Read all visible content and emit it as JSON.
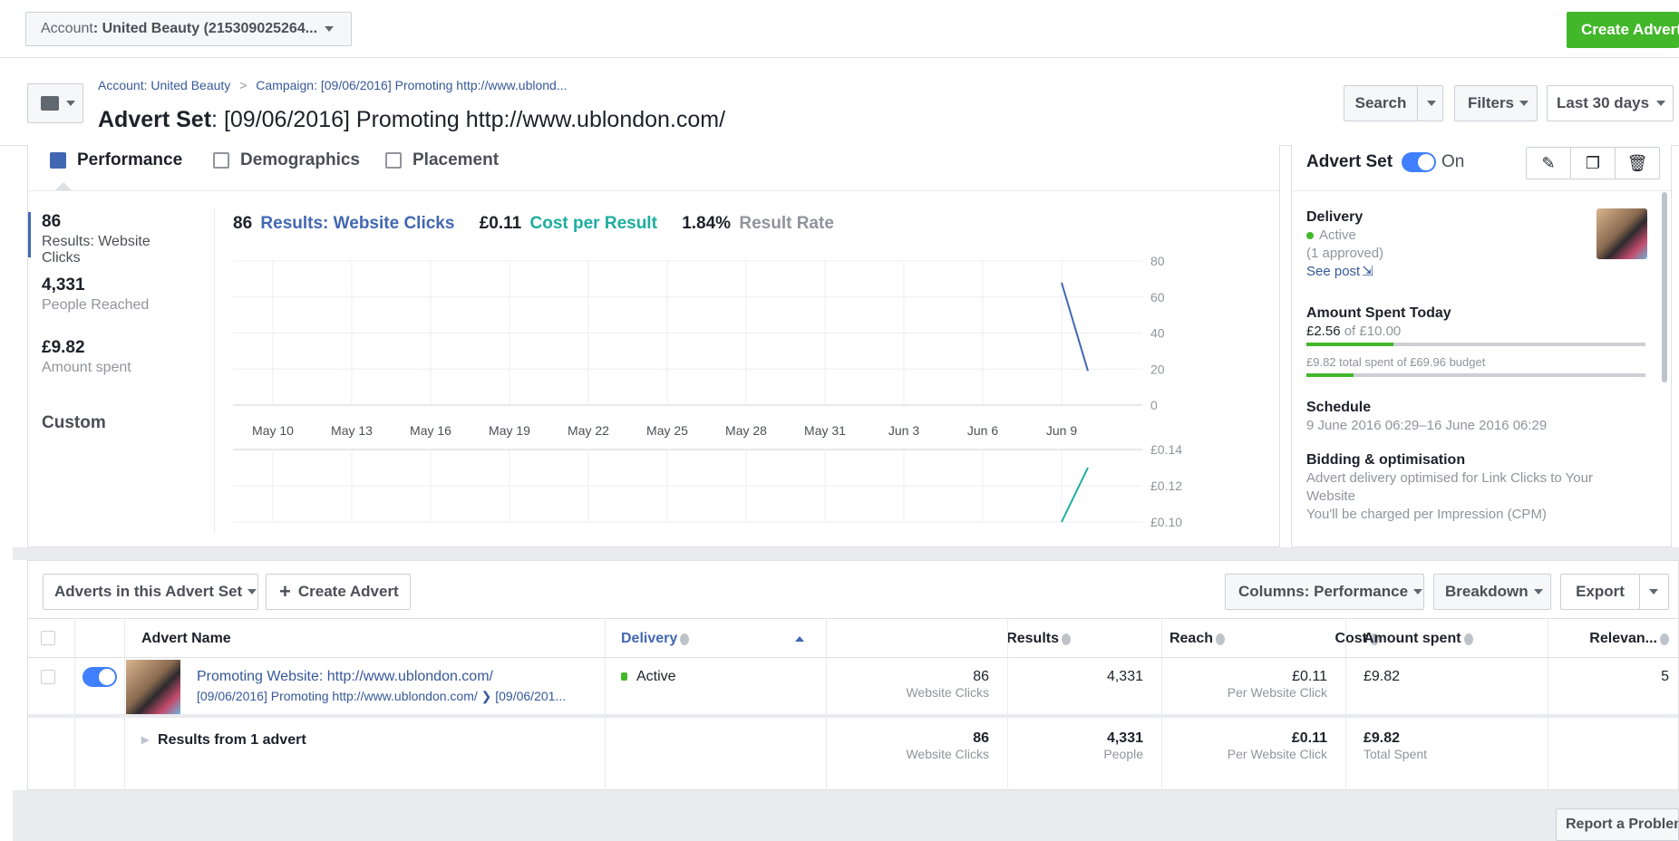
{
  "topbar": {
    "account_prefix": "Account",
    "account_value": ": United Beauty (215309025264...",
    "create_advert": "Create Advert"
  },
  "header": {
    "breadcrumb_account": "Account: United Beauty",
    "breadcrumb_campaign": "Campaign: [09/06/2016] Promoting http://www.ublond...",
    "title_prefix": "Advert Set",
    "title_value": ": [09/06/2016] Promoting http://www.ublondon.com/",
    "search": "Search",
    "filters": "Filters",
    "date_range": "Last 30 days"
  },
  "tabs": [
    "Performance",
    "Demographics",
    "Placement"
  ],
  "metrics": [
    {
      "value": "86",
      "label": "Results: Website Clicks"
    },
    {
      "value": "4,331",
      "label": "People Reached"
    },
    {
      "value": "£9.82",
      "label": "Amount spent"
    }
  ],
  "custom_label": "Custom",
  "chart_header": {
    "results_value": "86",
    "results_label": "Results: Website Clicks",
    "cost_value": "£0.11",
    "cost_label": "Cost per Result",
    "rate_value": "1.84%",
    "rate_label": "Result Rate"
  },
  "chart_data": [
    {
      "type": "line",
      "title": "",
      "x": [
        "May 10",
        "May 13",
        "May 16",
        "May 19",
        "May 22",
        "May 25",
        "May 28",
        "May 31",
        "Jun 3",
        "Jun 6",
        "Jun 9"
      ],
      "ylim": [
        0,
        80
      ],
      "yticks": [
        "80",
        "60",
        "40",
        "20",
        "0"
      ],
      "series": [
        {
          "name": "Results: Website Clicks",
          "color": "#4267b2",
          "points": [
            {
              "x": "Jun 9",
              "y": 68
            },
            {
              "x": "Jun 10",
              "y": 19
            }
          ]
        }
      ]
    },
    {
      "type": "line",
      "title": "",
      "ylim": [
        0.1,
        0.14
      ],
      "yticks": [
        "£0.14",
        "£0.12",
        "£0.10"
      ],
      "series": [
        {
          "name": "Cost per Result",
          "color": "#1cae9f",
          "points": [
            {
              "x": "Jun 9",
              "y": 0.1
            },
            {
              "x": "Jun 10",
              "y": 0.13
            }
          ]
        }
      ]
    }
  ],
  "advert_set_panel": {
    "title": "Advert Set",
    "status": "On",
    "delivery_title": "Delivery",
    "delivery_status": "Active",
    "delivery_note": "(1 approved)",
    "see_post": "See post",
    "amount_title": "Amount Spent Today",
    "amount_spent": "£2.56",
    "amount_of": " of £10.00",
    "amount_today_fraction": 0.256,
    "total_spent_text": "£9.82 total spent of £69.96 budget",
    "total_budget_fraction": 0.14,
    "schedule_title": "Schedule",
    "schedule_text": "9 June 2016 06:29–16 June 2016 06:29",
    "bidding_title": "Bidding & optimisation",
    "bidding_text": "Advert delivery optimised for Link Clicks to Your Website",
    "bidding_charge": "You'll be charged per Impression (CPM)"
  },
  "table_toolbar": {
    "adverts_dropdown": "Adverts in this Advert Set",
    "create_advert": "Create Advert",
    "columns": "Columns: Performance",
    "breakdown": "Breakdown",
    "export": "Export"
  },
  "table": {
    "headers": [
      "Advert Name",
      "Delivery",
      "Results",
      "Reach",
      "Cost",
      "Amount spent",
      "Relevan..."
    ],
    "row": {
      "name": "Promoting Website: http://www.ublondon.com/",
      "sub": "[09/06/2016] Promoting http://www.ublondon.com/ ❯ [09/06/201...",
      "delivery": "Active",
      "results": "86",
      "results_sub": "Website Clicks",
      "reach": "4,331",
      "cost": "£0.11",
      "cost_sub": "Per Website Click",
      "amount": "£9.82",
      "relevance": "5"
    },
    "summary": {
      "label": "Results from 1 advert",
      "results": "86",
      "results_sub": "Website Clicks",
      "reach": "4,331",
      "reach_sub": "People",
      "cost": "£0.11",
      "cost_sub": "Per Website Click",
      "amount": "£9.82",
      "amount_sub": "Total Spent"
    }
  },
  "footer": {
    "report_problem": "Report a Problem"
  },
  "colors": {
    "accent": "#4267b2",
    "green": "#42b72a",
    "teal": "#1cae9f",
    "toggle": "#4080ff"
  }
}
